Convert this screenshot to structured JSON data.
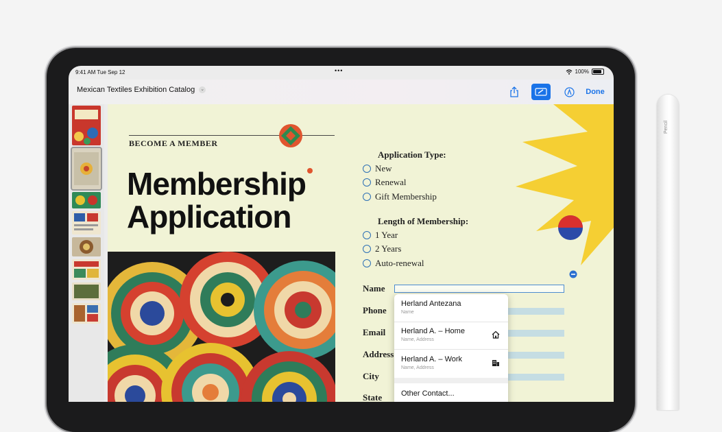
{
  "status": {
    "time": "9:41 AM  Tue Sep 12",
    "battery": "100%",
    "dots": "•••"
  },
  "toolbar": {
    "title": "Mexican Textiles Exhibition Catalog",
    "done_label": "Done"
  },
  "document": {
    "kicker": "BECOME A MEMBER",
    "title_line1": "Membership",
    "title_line2": "Application",
    "application_type": {
      "heading": "Application Type:",
      "options": [
        "New",
        "Renewal",
        "Gift Membership"
      ]
    },
    "length": {
      "heading": "Length of Membership:",
      "options": [
        "1 Year",
        "2 Years",
        "Auto-renewal"
      ]
    },
    "fields": [
      "Name",
      "Phone",
      "Email",
      "Address",
      "City",
      "State"
    ]
  },
  "autofill": {
    "items": [
      {
        "main": "Herland Antezana",
        "sub": "Name",
        "icon": ""
      },
      {
        "main": "Herland A. – Home",
        "sub": "Name, Address",
        "icon": "house-icon"
      },
      {
        "main": "Herland A. – Work",
        "sub": "Name, Address",
        "icon": "building-icon"
      },
      {
        "main": "Other Contact...",
        "sub": "",
        "icon": ""
      }
    ]
  },
  "pencil": {
    "label": "Pencil"
  },
  "colors": {
    "accent": "#1a73e8",
    "page": "#f1f3d6",
    "sun": "#f5cf33"
  }
}
